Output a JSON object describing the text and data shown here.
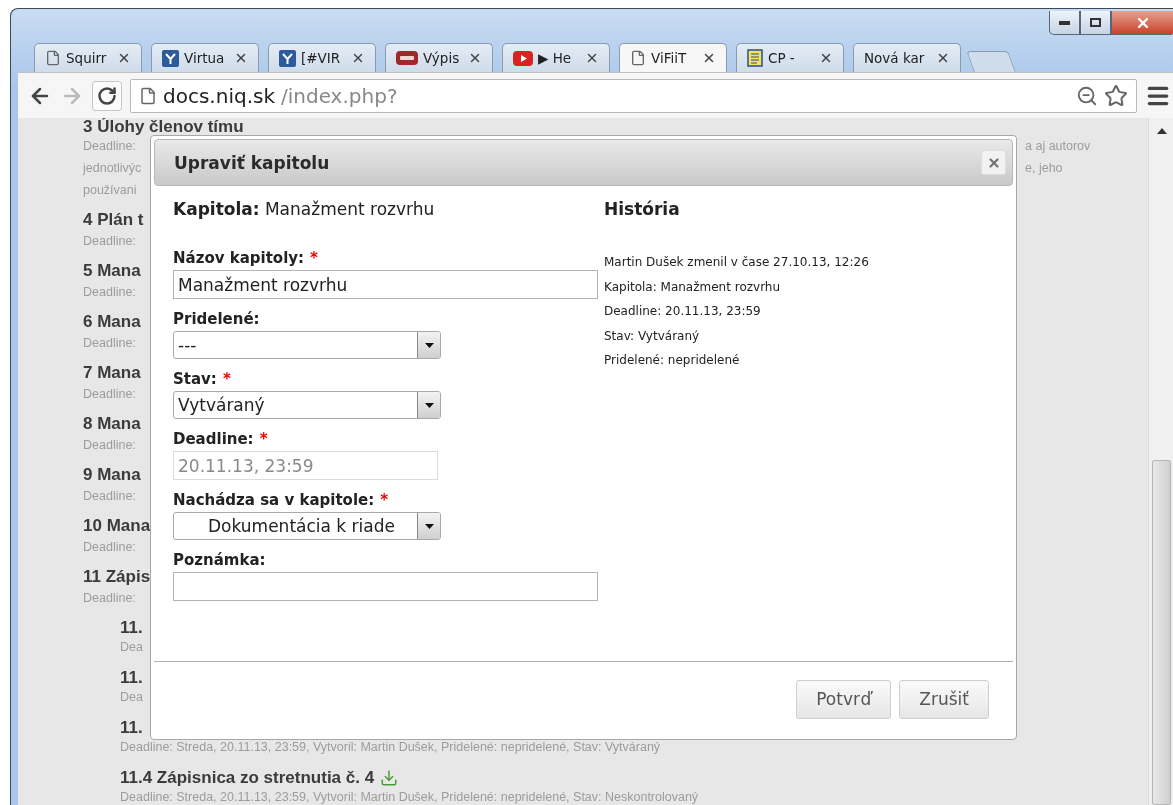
{
  "tabs": [
    {
      "title": "Squirr",
      "kind": "page",
      "selected": false
    },
    {
      "title": "Virtua",
      "kind": "mark",
      "selected": false
    },
    {
      "title": "[#VIR",
      "kind": "mark",
      "selected": false
    },
    {
      "title": "Výpis",
      "kind": "ais",
      "selected": false
    },
    {
      "title": "▶ He",
      "kind": "video",
      "selected": false
    },
    {
      "title": "ViFiiT",
      "kind": "page",
      "selected": true
    },
    {
      "title": "CP -",
      "kind": "doc",
      "selected": false
    },
    {
      "title": "Nová kar",
      "kind": "plain",
      "selected": false
    }
  ],
  "toolbar": {
    "forward_disabled": true,
    "url_host": "docs.niq.sk",
    "url_path": "/index.php?"
  },
  "background": {
    "items": [
      {
        "title": "3 Úlohy členov tímu",
        "download": false,
        "lines": [
          {
            "left": "Deadline:",
            "right": "a aj autorov"
          },
          {
            "left": "jednotlivýc",
            "right": "e, jeho"
          },
          {
            "left": "používani"
          }
        ]
      },
      {
        "title": "4 Plán t",
        "download": false,
        "lines": [
          {
            "left": "Deadline:"
          }
        ]
      },
      {
        "title": "5 Mana",
        "download": false,
        "lines": [
          {
            "left": "Deadline:"
          }
        ]
      },
      {
        "title": "6 Mana",
        "download": false,
        "lines": [
          {
            "left": "Deadline:"
          }
        ]
      },
      {
        "title": "7 Mana",
        "download": false,
        "lines": [
          {
            "left": "Deadline:"
          }
        ]
      },
      {
        "title": "8 Mana",
        "download": false,
        "lines": [
          {
            "left": "Deadline:"
          }
        ]
      },
      {
        "title": "9 Mana",
        "download": false,
        "lines": [
          {
            "left": "Deadline:"
          }
        ]
      },
      {
        "title": "10 Mana",
        "download": false,
        "lines": [
          {
            "left": "Deadline:"
          }
        ]
      },
      {
        "title": "11 Zápis",
        "download": false,
        "lines": [
          {
            "left": "Deadline:"
          }
        ],
        "children": [
          {
            "title": "11.",
            "download": false,
            "lines": [
              {
                "left": "Dea"
              }
            ]
          },
          {
            "title": "11.",
            "download": false,
            "lines": [
              {
                "left": "Dea"
              }
            ]
          },
          {
            "title": "11.",
            "download": false,
            "lines": [
              {
                "left": "Deadline: Streda, 20.11.13, 23:59, Vytvoril: Martin Dušek, Pridelené: nepridelené, Stav: Vytváraný"
              }
            ]
          },
          {
            "title": "11.4 Zápisnica zo stretnutia č. 4",
            "download": true,
            "lines": [
              {
                "left": "Deadline: Streda, 20.11.13, 23:59, Vytvoril: Martin Dušek, Pridelené: nepridelené, Stav: Neskontrolovaný"
              }
            ]
          }
        ]
      }
    ]
  },
  "dialog": {
    "title": "Upraviť kapitolu",
    "chapter_label": "Kapitola:",
    "chapter_value": "Manažment rozvrhu",
    "fields": [
      {
        "kind": "text",
        "label": "Názov kapitoly:",
        "mark": "*",
        "value": "Manažment rozvrhu",
        "disabled": false
      },
      {
        "kind": "select",
        "label": "Pridelené:",
        "value": "---",
        "disabled": false,
        "indented": false
      },
      {
        "kind": "select",
        "label": "Stav:",
        "mark": "*",
        "value": "Vytváraný",
        "disabled": false,
        "indented": false
      },
      {
        "kind": "date",
        "label": "Deadline:",
        "mark": "*",
        "value": "20.11.13, 23:59",
        "disabled": true
      },
      {
        "kind": "select",
        "label": "Nachádza sa v kapitole:",
        "mark": "*",
        "value": "Dokumentácia k riade",
        "disabled": false,
        "indented": true
      },
      {
        "kind": "text",
        "label": "Poznámka:",
        "disabled": false
      }
    ],
    "history": {
      "title": "História",
      "lines": [
        "Martin Dušek zmenil v čase 27.10.13, 12:26",
        "Kapitola: Manažment rozvrhu",
        "Deadline: 20.11.13, 23:59",
        "Stav: Vytváraný",
        "Pridelené: nepridelené"
      ]
    },
    "buttons": [
      "Potvrď",
      "Zrušiť"
    ]
  }
}
